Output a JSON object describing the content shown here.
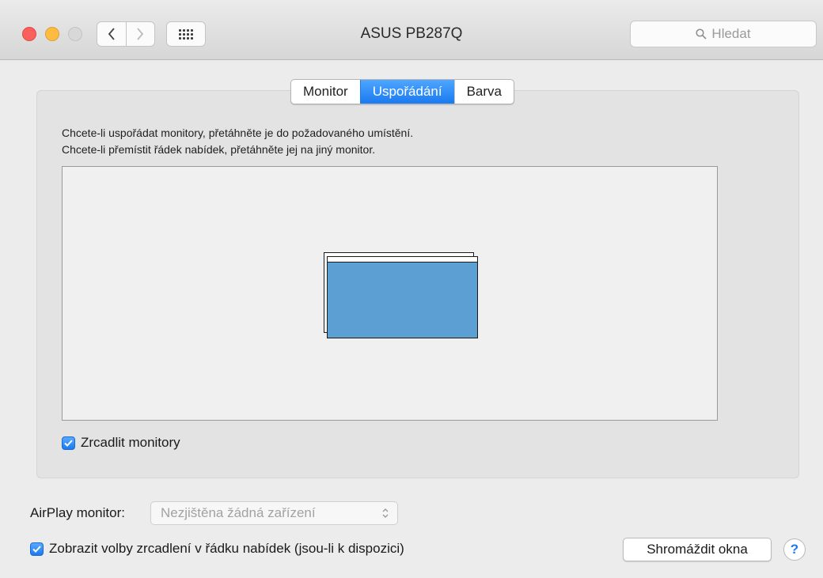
{
  "window": {
    "title": "ASUS PB287Q"
  },
  "toolbar": {
    "search_placeholder": "Hledat"
  },
  "tabs": [
    {
      "label": "Monitor",
      "active": false
    },
    {
      "label": "Uspořádání",
      "active": true
    },
    {
      "label": "Barva",
      "active": false
    }
  ],
  "instructions": {
    "line1": "Chcete-li uspořádat monitory, přetáhněte je do požadovaného umístění.",
    "line2": "Chcete-li přemístit řádek nabídek, přetáhněte jej na jiný monitor."
  },
  "mirror": {
    "label": "Zrcadlit monitory",
    "checked": true
  },
  "airplay": {
    "label": "AirPlay monitor:",
    "value": "Nezjištěna žádná zařízení"
  },
  "show_mirroring": {
    "label": "Zobrazit volby zrcadlení v řádku nabídek (jsou-li k dispozici)",
    "checked": true
  },
  "gather_button": {
    "label": "Shromáždit okna"
  },
  "help": {
    "label": "?"
  },
  "colors": {
    "accent": "#1a7af0",
    "monitor_fill": "#5b9fd3",
    "close": "#fc605c",
    "minimize": "#fdbc40"
  }
}
